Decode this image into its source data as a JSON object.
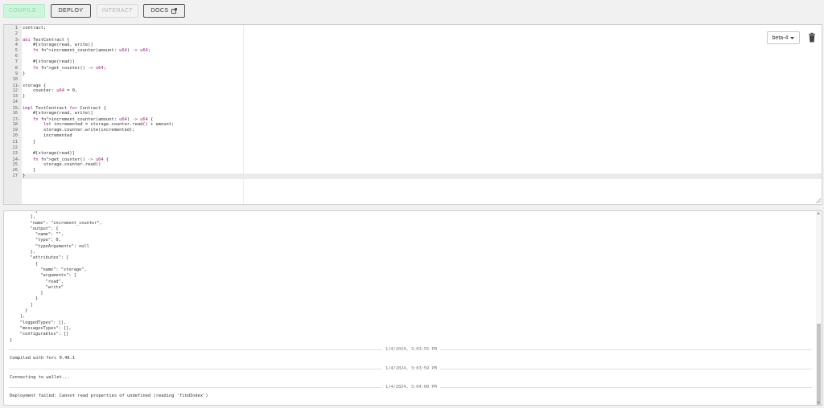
{
  "toolbar": {
    "compile_label": "COMPILE",
    "compile_icon": "play-icon",
    "deploy_label": "DEPLOY",
    "interact_label": "INTERACT",
    "docs_label": "DOCS",
    "docs_icon": "external-link-icon"
  },
  "editor": {
    "toolchain_selected": "beta-4",
    "delete_icon": "trash-icon",
    "lines": [
      {
        "n": "1",
        "fold": false,
        "code": "contract;"
      },
      {
        "n": "2",
        "fold": false,
        "code": ""
      },
      {
        "n": "3",
        "fold": true,
        "code": "abi TestContract {"
      },
      {
        "n": "4",
        "fold": false,
        "code": "    #[storage(read, write)]"
      },
      {
        "n": "5",
        "fold": false,
        "code": "    fn increment_counter(amount: u64) -> u64;"
      },
      {
        "n": "6",
        "fold": false,
        "code": ""
      },
      {
        "n": "7",
        "fold": false,
        "code": "    #[storage(read)]"
      },
      {
        "n": "8",
        "fold": false,
        "code": "    fn get_counter() -> u64;"
      },
      {
        "n": "9",
        "fold": false,
        "code": "}"
      },
      {
        "n": "10",
        "fold": false,
        "code": ""
      },
      {
        "n": "11",
        "fold": true,
        "code": "storage {"
      },
      {
        "n": "12",
        "fold": false,
        "code": "    counter: u64 = 0,"
      },
      {
        "n": "13",
        "fold": false,
        "code": "}"
      },
      {
        "n": "14",
        "fold": false,
        "code": ""
      },
      {
        "n": "15",
        "fold": true,
        "code": "impl TestContract for Contract {"
      },
      {
        "n": "16",
        "fold": false,
        "code": "    #[storage(read, write)]"
      },
      {
        "n": "17",
        "fold": true,
        "code": "    fn increment_counter(amount: u64) -> u64 {"
      },
      {
        "n": "18",
        "fold": false,
        "code": "        let incremented = storage.counter.read() + amount;"
      },
      {
        "n": "19",
        "fold": false,
        "code": "        storage.counter.write(incremented);"
      },
      {
        "n": "20",
        "fold": false,
        "code": "        incremented"
      },
      {
        "n": "21",
        "fold": false,
        "code": "    }"
      },
      {
        "n": "22",
        "fold": false,
        "code": ""
      },
      {
        "n": "23",
        "fold": false,
        "code": "    #[storage(read)]"
      },
      {
        "n": "24",
        "fold": true,
        "code": "    fn get_counter() -> u64 {"
      },
      {
        "n": "25",
        "fold": false,
        "code": "        storage.counter.read()"
      },
      {
        "n": "26",
        "fold": false,
        "code": "    }"
      },
      {
        "n": "27",
        "fold": false,
        "code": "}"
      }
    ]
  },
  "console": {
    "json_lines": [
      "          }",
      "        ],",
      "        \"name\": \"increment_counter\",",
      "        \"output\": {",
      "          \"name\": \"\",",
      "          \"type\": 0,",
      "          \"typeArguments\": null",
      "        },",
      "        \"attributes\": [",
      "          {",
      "            \"name\": \"storage\",",
      "            \"arguments\": [",
      "              \"read\",",
      "              \"write\"",
      "            ]",
      "          }",
      "        ]",
      "      }",
      "    ],",
      "    \"loggedTypes\": [],",
      "    \"messagesTypes\": [],",
      "    \"configurables\": []",
      "}"
    ],
    "entries": [
      {
        "timestamp": "1/4/2024, 3:03:55 PM",
        "message": "Compiled with forc 0.46.1"
      },
      {
        "timestamp": "1/4/2024, 3:03:59 PM",
        "message": "Connecting to wallet..."
      },
      {
        "timestamp": "1/4/2024, 3:04:00 PM",
        "message": "Deployment failed: Cannot read properties of undefined (reading 'findIndex')"
      }
    ]
  }
}
